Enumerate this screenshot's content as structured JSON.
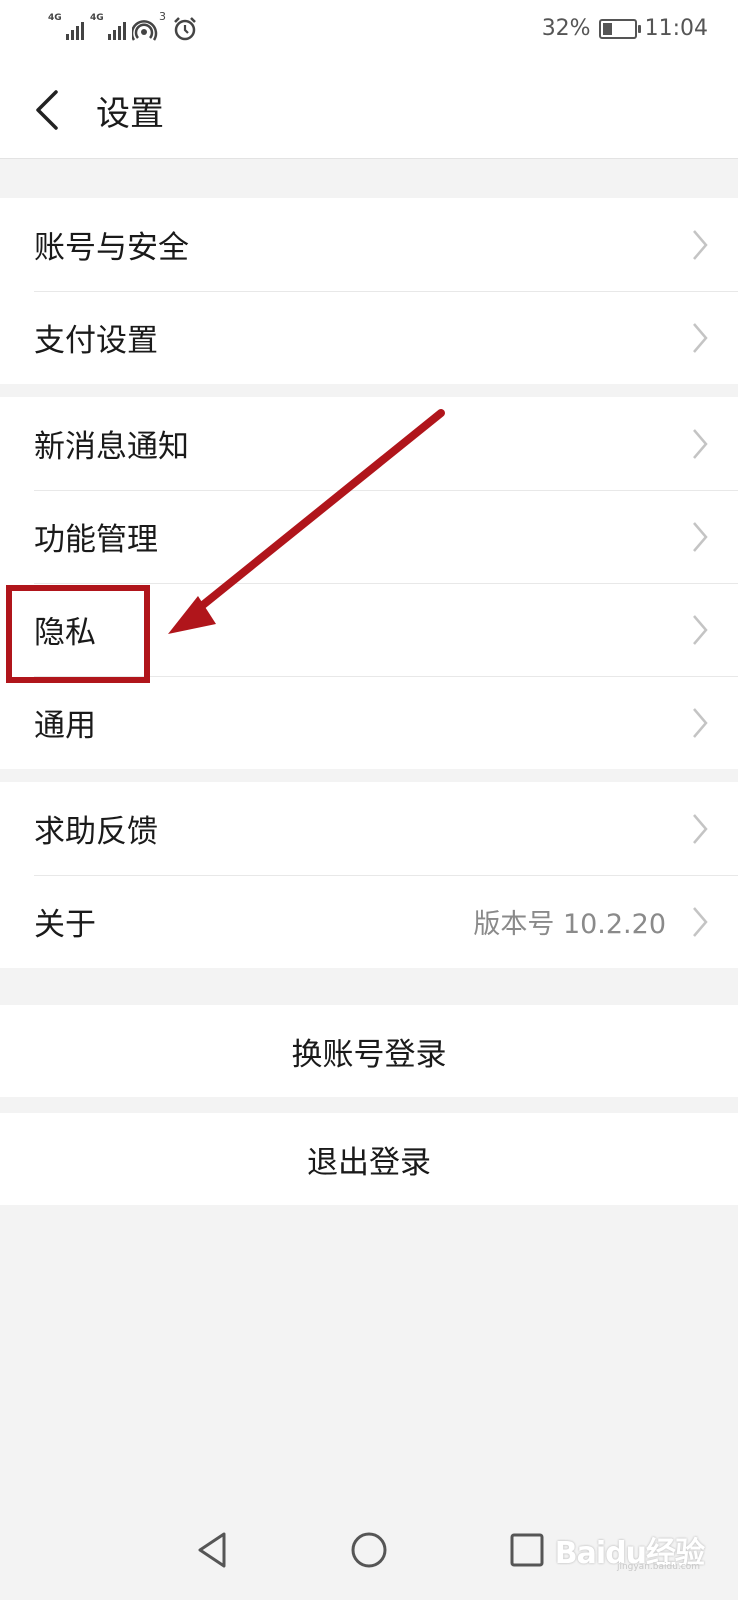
{
  "status_bar": {
    "network_1": "4G",
    "network_2": "4G",
    "hotspot_count": "3",
    "battery_percent": "32%",
    "battery_level": 0.32,
    "time": "11:04"
  },
  "header": {
    "title": "设置"
  },
  "groups": [
    {
      "items": [
        {
          "label": "账号与安全"
        },
        {
          "label": "支付设置"
        }
      ]
    },
    {
      "items": [
        {
          "label": "新消息通知"
        },
        {
          "label": "功能管理"
        },
        {
          "label": "隐私"
        },
        {
          "label": "通用"
        }
      ]
    },
    {
      "items": [
        {
          "label": "求助反馈"
        },
        {
          "label": "关于",
          "value": "版本号 10.2.20"
        }
      ]
    }
  ],
  "actions": {
    "switch_account": "换账号登录",
    "logout": "退出登录"
  },
  "annotation": {
    "highlight_color": "#b0151b",
    "highlighted_item": "隐私"
  },
  "icons": {
    "back": "chevron-left-icon",
    "row_arrow": "chevron-right-icon",
    "nav_back": "triangle-back-icon",
    "nav_home": "circle-home-icon",
    "nav_recents": "square-recents-icon"
  },
  "watermark": {
    "brand": "Baidu经验",
    "url": "jingyan.baidu.com"
  }
}
